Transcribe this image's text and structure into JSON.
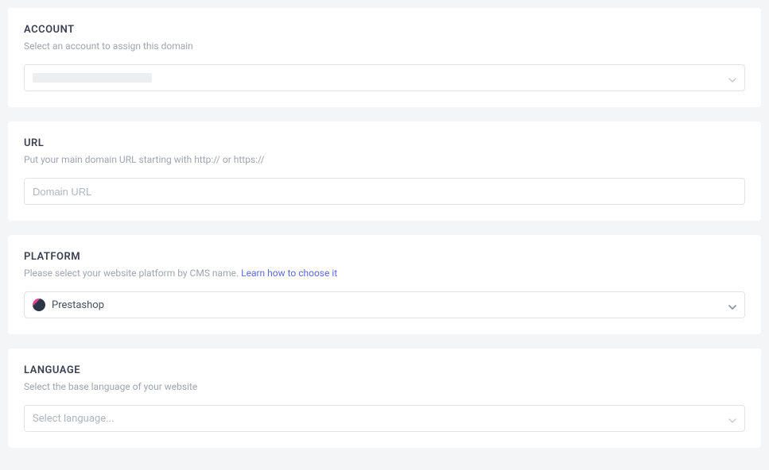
{
  "account": {
    "title": "ACCOUNT",
    "desc": "Select an account to assign this domain"
  },
  "url": {
    "title": "URL",
    "desc": "Put your main domain URL starting with http:// or https://",
    "placeholder": "Domain URL"
  },
  "platform": {
    "title": "PLATFORM",
    "desc": "Please select your website platform by CMS name. ",
    "link": "Learn how to choose it",
    "value": "Prestashop"
  },
  "language": {
    "title": "LANGUAGE",
    "desc": "Select the base language of your website",
    "placeholder": "Select language..."
  }
}
